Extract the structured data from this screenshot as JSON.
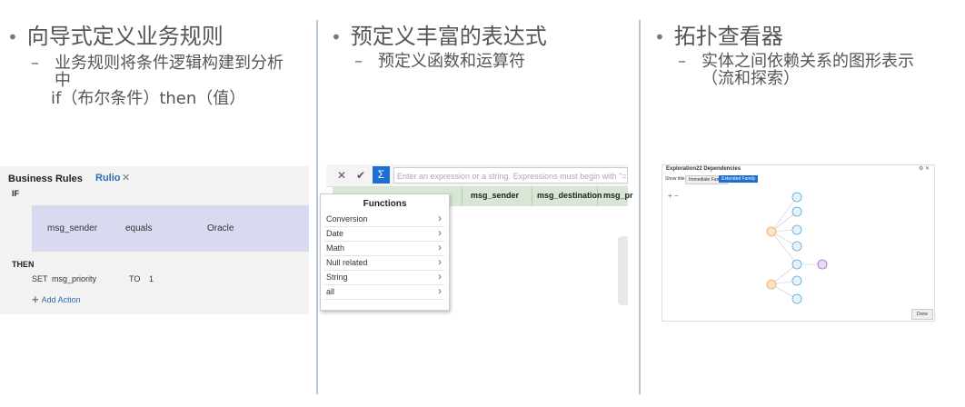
{
  "columns": [
    {
      "bullet": "向导式定义业务规则",
      "sub": [
        "业务规则将条件逻辑构建到分析",
        "中",
        "if（布尔条件）then（值）"
      ]
    },
    {
      "bullet": "预定义丰富的表达式",
      "sub": [
        "预定义函数和运算符"
      ]
    },
    {
      "bullet": "拓扑查看器",
      "sub": [
        "实体之间依赖关系的图形表示",
        "（流和探索）"
      ]
    }
  ],
  "business_rules": {
    "title": "Business Rules",
    "rule_name": "Rulio",
    "close_glyph": "✕",
    "if_label": "IF",
    "condition": {
      "field": "msg_sender",
      "operator": "equals",
      "value": "Oracle"
    },
    "then_label": "THEN",
    "action": {
      "set": "SET",
      "field": "msg_priority",
      "to": "TO",
      "value": "1"
    },
    "add_action": "Add Action"
  },
  "expression_editor": {
    "cancel_glyph": "✕",
    "ok_glyph": "✔",
    "sigma_glyph": "Σ",
    "placeholder": "Enter an expression or a string. Expressions must begin with \"=\"",
    "columns": [
      "msg_sender",
      "msg_destination",
      "msg_pr"
    ],
    "functions_title": "Functions",
    "functions": [
      "Conversion",
      "Date",
      "Math",
      "Null related",
      "String",
      "all"
    ]
  },
  "dependencies": {
    "title": "Exploration22 Dependencies",
    "controls": "⚙ ✕",
    "show_label": "Show title",
    "tabs": [
      "Immediate Family",
      "Extended Family"
    ],
    "active_tab": "Extended Family",
    "zoom": "+ −",
    "done": "Done"
  },
  "colors": {
    "accent": "#2d6db3",
    "divider": "#b7c7d6",
    "condition_bg": "#d9d9f0",
    "grid_header": "#d8e6d5",
    "sigma": "#1d6fd1"
  }
}
